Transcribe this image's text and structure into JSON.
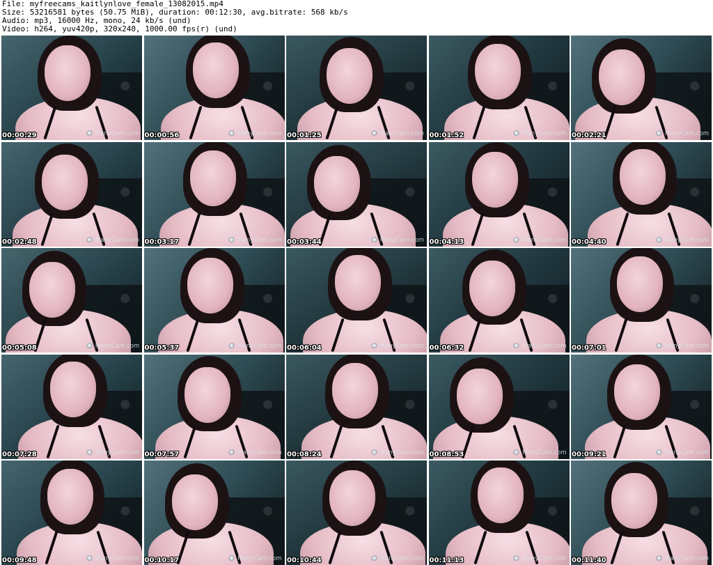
{
  "header": {
    "file_line": "File: myfreecams_kaitlynlove_female_13082015.mp4",
    "size_line": "Size: 53216581 bytes (50.75 MiB), duration: 00:12:30, avg.bitrate: 568 kb/s",
    "audio_line": "Audio: mp3, 16000 Hz, mono, 24 kb/s (und)",
    "video_line": "Video: h264, yuv420p, 320x240, 1000.00 fps(r) (und)"
  },
  "watermark_text": "ManyCam.com",
  "thumbnails": [
    {
      "timestamp": "00:00:29"
    },
    {
      "timestamp": "00:00:56"
    },
    {
      "timestamp": "00:01:25"
    },
    {
      "timestamp": "00:01:52"
    },
    {
      "timestamp": "00:02:21"
    },
    {
      "timestamp": "00:02:48"
    },
    {
      "timestamp": "00:03:17"
    },
    {
      "timestamp": "00:03:44"
    },
    {
      "timestamp": "00:04:13"
    },
    {
      "timestamp": "00:04:40"
    },
    {
      "timestamp": "00:05:08"
    },
    {
      "timestamp": "00:05:37"
    },
    {
      "timestamp": "00:06:04"
    },
    {
      "timestamp": "00:06:32"
    },
    {
      "timestamp": "00:07:01"
    },
    {
      "timestamp": "00:07:28"
    },
    {
      "timestamp": "00:07:57"
    },
    {
      "timestamp": "00:08:24"
    },
    {
      "timestamp": "00:08:53"
    },
    {
      "timestamp": "00:09:21"
    },
    {
      "timestamp": "00:09:48"
    },
    {
      "timestamp": "00:10:17"
    },
    {
      "timestamp": "00:10:44"
    },
    {
      "timestamp": "00:11:13"
    },
    {
      "timestamp": "00:11:40"
    }
  ]
}
